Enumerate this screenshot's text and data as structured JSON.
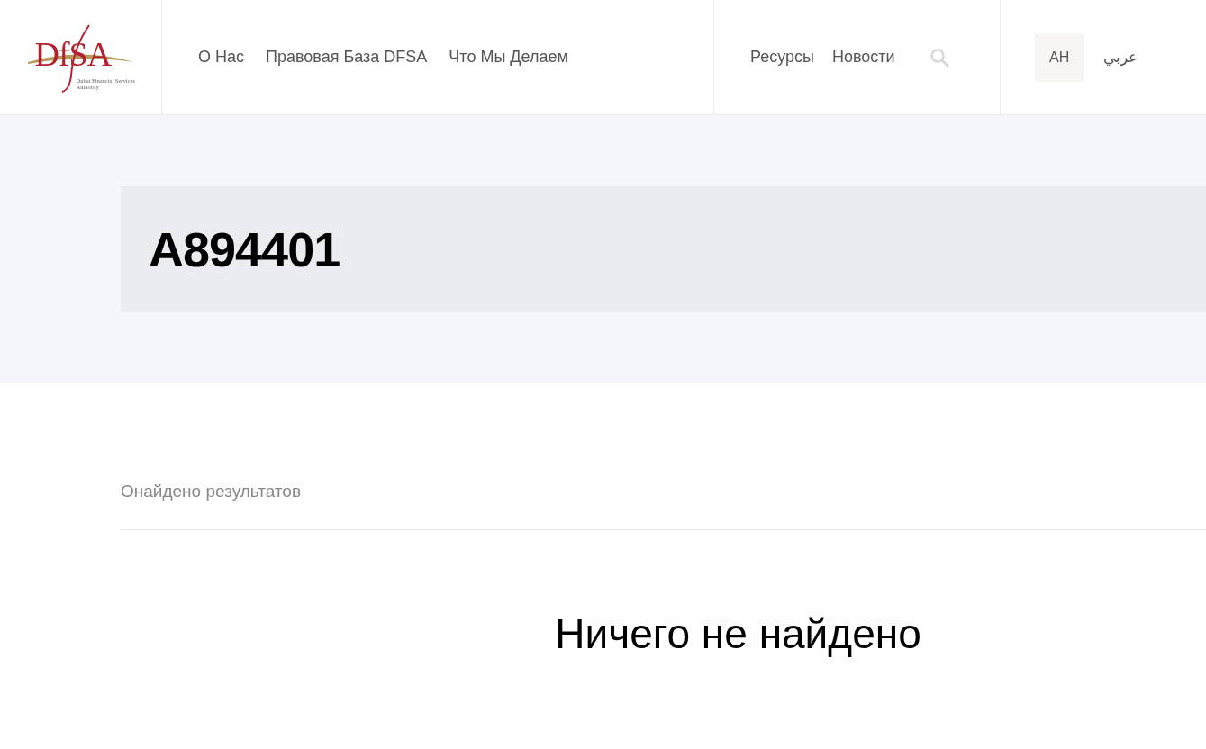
{
  "logo": {
    "mark": "DfSA",
    "subtitle": "Dubai Financial Services Authority"
  },
  "nav_main": [
    {
      "label": "О Нас"
    },
    {
      "label": "Правовая База DFSA"
    },
    {
      "label": "Что Мы Делаем"
    }
  ],
  "nav_secondary": [
    {
      "label": "Ресурсы"
    },
    {
      "label": "Новости"
    }
  ],
  "languages": [
    {
      "label": "AH",
      "selected": true
    },
    {
      "label": "عربي",
      "selected": false
    }
  ],
  "search_title": "A894401",
  "results_count": "Онайдено результатов",
  "empty_message": "Ничего не найдено"
}
